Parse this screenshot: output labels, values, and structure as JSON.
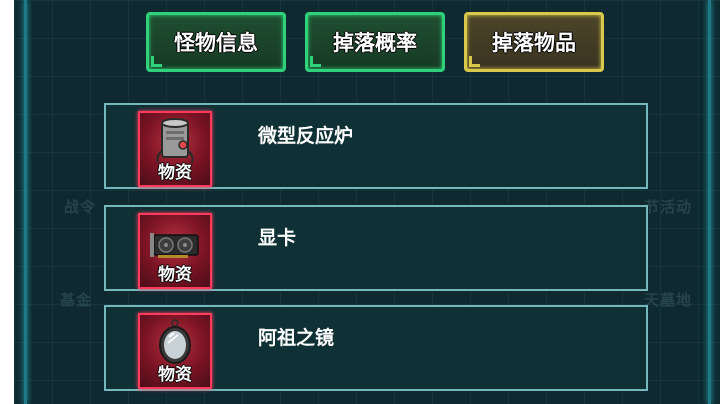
{
  "tabs": [
    {
      "label": "怪物信息",
      "state": "normal",
      "color": "#2fd27a"
    },
    {
      "label": "掉落概率",
      "state": "normal",
      "color": "#2fd27a"
    },
    {
      "label": "掉落物品",
      "state": "selected",
      "color": "#d9c84a"
    }
  ],
  "background_hints": {
    "left": [
      "战令",
      "基金"
    ],
    "right": [
      "节活动",
      "天墓地"
    ]
  },
  "items": [
    {
      "name": "微型反应炉",
      "category": "物资",
      "icon": "reactor-icon"
    },
    {
      "name": "显卡",
      "category": "物资",
      "icon": "graphics-card-icon"
    },
    {
      "name": "阿祖之镜",
      "category": "物资",
      "icon": "mirror-icon"
    }
  ]
}
